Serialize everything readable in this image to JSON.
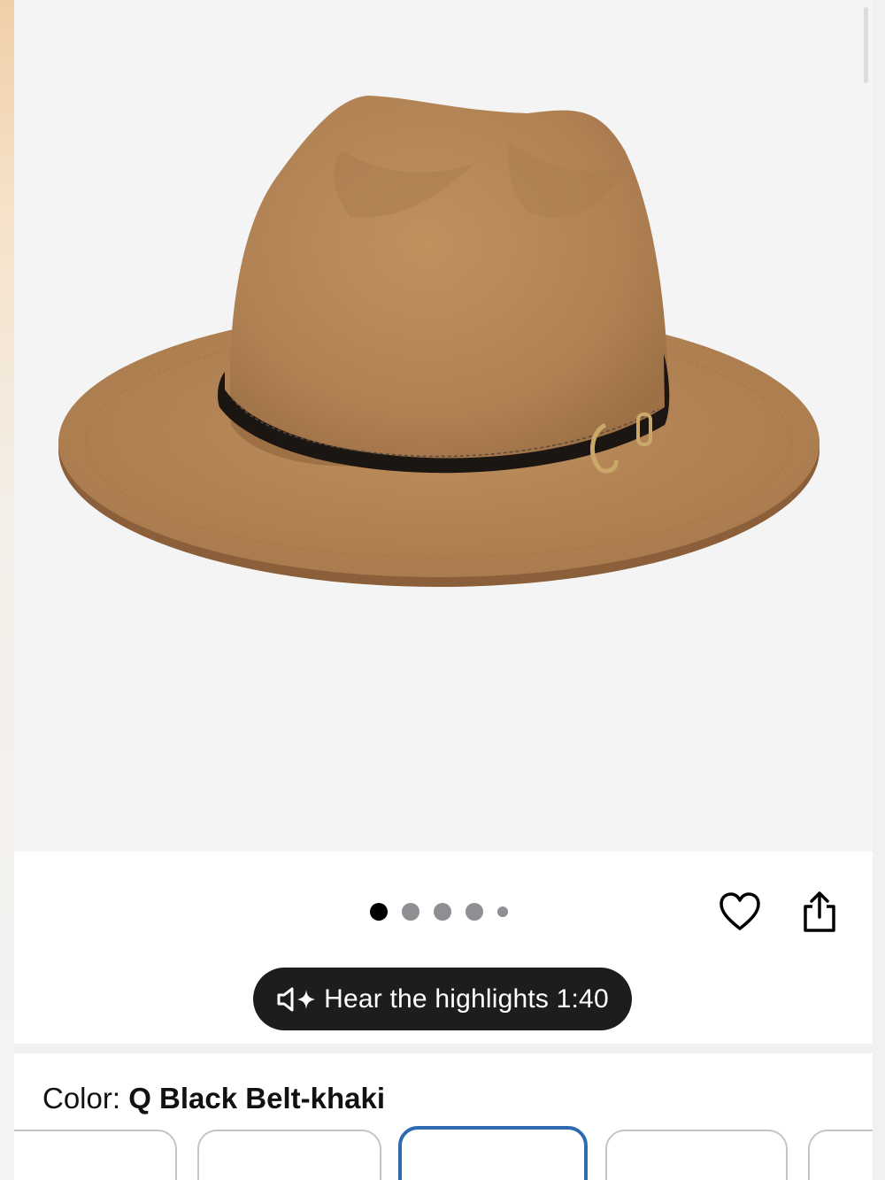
{
  "product": {
    "image_alt": "Camel felt fedora hat with black leather belt band",
    "carousel": {
      "total_images": 5,
      "active_index": 0
    }
  },
  "actions": {
    "favorite_icon": "heart-icon",
    "share_icon": "share-icon"
  },
  "audio_highlights": {
    "icon": "speaker-sparkle-icon",
    "label": "Hear the highlights 1:40"
  },
  "color_selector": {
    "label": "Color: ",
    "selected_value": "Q Black Belt-khaki",
    "selected_swatch_index": 2,
    "swatch_count": 5
  },
  "colors": {
    "accent_selected": "#2d6ab0",
    "pill_background": "#1d1d1f",
    "hat": "#b98a5a",
    "belt": "#1c1612"
  }
}
